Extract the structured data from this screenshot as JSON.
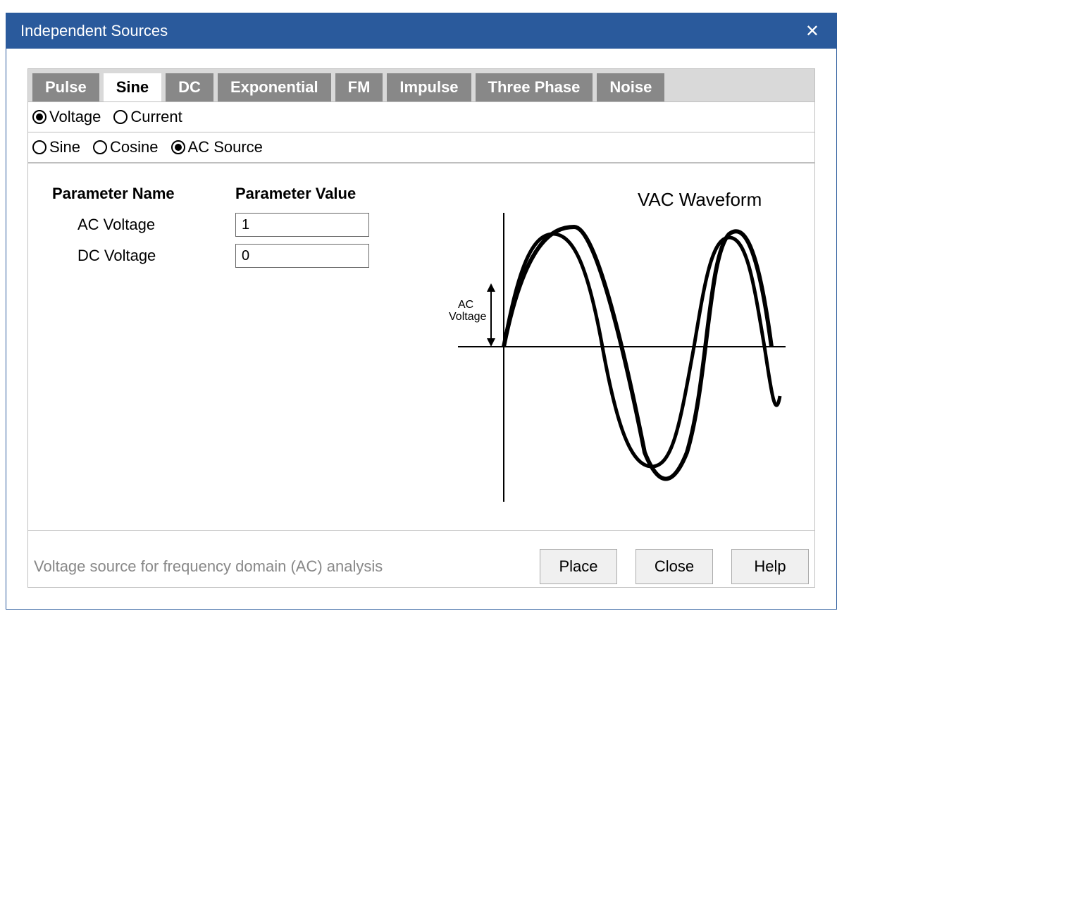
{
  "window": {
    "title": "Independent Sources"
  },
  "tabs": [
    {
      "label": "Pulse",
      "active": false
    },
    {
      "label": "Sine",
      "active": true
    },
    {
      "label": "DC",
      "active": false
    },
    {
      "label": "Exponential",
      "active": false
    },
    {
      "label": "FM",
      "active": false
    },
    {
      "label": "Impulse",
      "active": false
    },
    {
      "label": "Three Phase",
      "active": false
    },
    {
      "label": "Noise",
      "active": false
    }
  ],
  "source_kind": {
    "options": [
      {
        "label": "Voltage",
        "selected": true
      },
      {
        "label": "Current",
        "selected": false
      }
    ]
  },
  "wave_kind": {
    "options": [
      {
        "label": "Sine",
        "selected": false
      },
      {
        "label": "Cosine",
        "selected": false
      },
      {
        "label": "AC Source",
        "selected": true
      }
    ]
  },
  "param_header": {
    "name": "Parameter Name",
    "value": "Parameter Value"
  },
  "parameters": [
    {
      "label": "AC Voltage",
      "value": "1"
    },
    {
      "label": "DC Voltage",
      "value": "0"
    }
  ],
  "chart": {
    "title": "VAC Waveform",
    "y_axis_label": "AC\nVoltage"
  },
  "footer": {
    "description": "Voltage source for frequency domain (AC) analysis",
    "place": "Place",
    "close": "Close",
    "help": "Help"
  },
  "chart_data": {
    "type": "line",
    "title": "VAC Waveform",
    "description": "Illustrative sine wave starting near zero, peaking at +1 (AC Voltage amplitude), dipping to -1, for roughly two full cycles, with a slight upward offset possible from DC Voltage.",
    "x": [
      0,
      0.125,
      0.25,
      0.375,
      0.5,
      0.625,
      0.75,
      0.875,
      1.0,
      1.125,
      1.25,
      1.375,
      1.5,
      1.625,
      1.75,
      1.875
    ],
    "values": [
      0,
      0.71,
      1,
      0.71,
      0,
      -0.71,
      -1,
      -0.71,
      0,
      0.71,
      1,
      0.71,
      0,
      -0.71,
      -1,
      -0.5
    ],
    "ylabel": "AC Voltage",
    "xlabel": "",
    "ylim": [
      -1,
      1
    ],
    "ac_amplitude": 1,
    "dc_offset": 0,
    "cycles_shown": 2
  }
}
